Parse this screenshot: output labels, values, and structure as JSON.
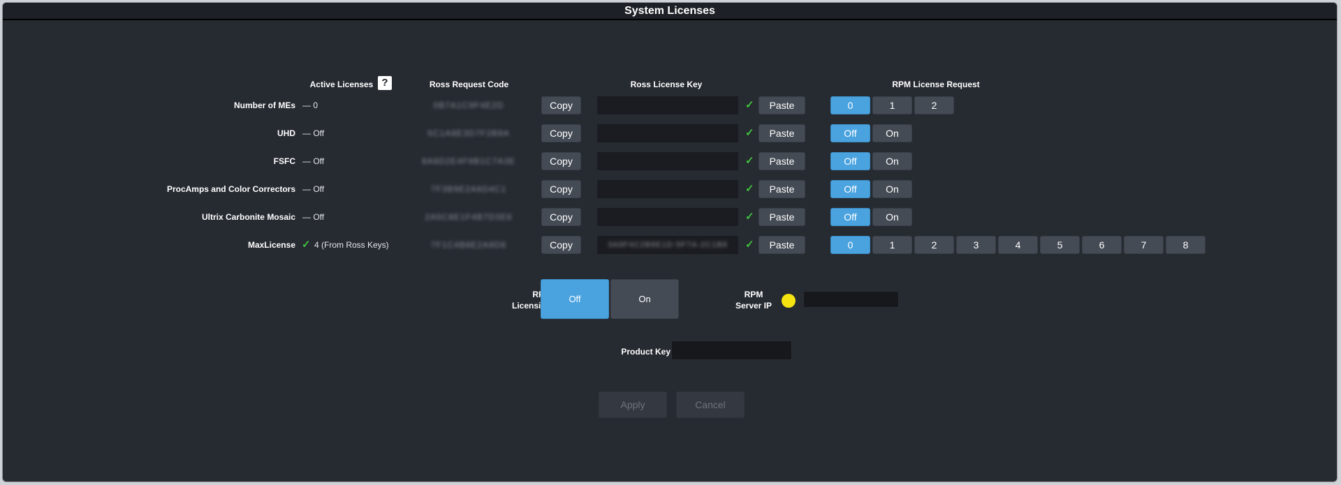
{
  "window": {
    "title": "System Licenses"
  },
  "headers": {
    "active_licenses": "Active Licenses",
    "help": "?",
    "request_code": "Ross Request Code",
    "license_key": "Ross License Key",
    "rpm_request": "RPM License Request"
  },
  "rows": [
    {
      "label": "Number of MEs",
      "status": "— 0",
      "request_code": "0B7A1C9F4E2D",
      "copy": "Copy",
      "key": "",
      "check": "✓",
      "paste": "Paste",
      "options": [
        "0",
        "1",
        "2"
      ],
      "selected": "0"
    },
    {
      "label": "UHD",
      "status": "— Off",
      "request_code": "5C1A8E3D7F2B9A",
      "copy": "Copy",
      "key": "",
      "check": "✓",
      "paste": "Paste",
      "options": [
        "Off",
        "On"
      ],
      "selected": "Off"
    },
    {
      "label": "FSFC",
      "status": "— Off",
      "request_code": "8A6D2E4F9B1C7A3E",
      "copy": "Copy",
      "key": "",
      "check": "✓",
      "paste": "Paste",
      "options": [
        "Off",
        "On"
      ],
      "selected": "Off"
    },
    {
      "label": "ProcAmps and Color Correctors",
      "status": "— Off",
      "request_code": "7F3B9E2A6D4C1",
      "copy": "Copy",
      "key": "",
      "check": "✓",
      "paste": "Paste",
      "options": [
        "Off",
        "On"
      ],
      "selected": "Off"
    },
    {
      "label": "Ultrix Carbonite Mosaic",
      "status": "— Off",
      "request_code": "2A5C8E1F4B7D3E6",
      "copy": "Copy",
      "key": "",
      "check": "✓",
      "paste": "Paste",
      "options": [
        "Off",
        "On"
      ],
      "selected": "Off"
    },
    {
      "label": "MaxLicense",
      "status": "4 (From Ross Keys)",
      "status_check": "✓",
      "request_code": "7F1C4B8E2A9D6",
      "copy": "Copy",
      "key": "3A9F4C2B8E1D-5F7A-2C1B8",
      "check": "✓",
      "paste": "Paste",
      "options": [
        "0",
        "1",
        "2",
        "3",
        "4",
        "5",
        "6",
        "7",
        "8"
      ],
      "selected": "0"
    }
  ],
  "rpm": {
    "licensing_label_1": "RPM",
    "licensing_label_2": "Licensing",
    "off": "Off",
    "on": "On",
    "selected": "Off",
    "server_label_1": "RPM",
    "server_label_2": "Server IP",
    "server_ip": "",
    "status_color": "#f5e410"
  },
  "product_key": {
    "label": "Product Key",
    "value": ""
  },
  "actions": {
    "apply": "Apply",
    "cancel": "Cancel"
  },
  "colors": {
    "accent": "#4aa3df",
    "check": "#3fc43f",
    "background": "#262a31"
  }
}
